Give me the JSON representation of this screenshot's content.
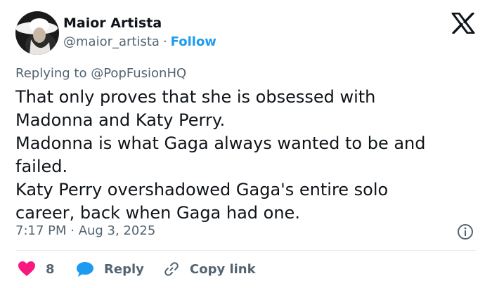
{
  "author": {
    "name": "Maior Artista",
    "handle": "@maior_artista",
    "separator": "·",
    "follow_label": "Follow"
  },
  "brand": {
    "icon": "x-logo-icon"
  },
  "reply_context": {
    "prefix": "Replying to",
    "mention": "@PopFusionHQ"
  },
  "tweet": {
    "lines": [
      "That only proves that she is obsessed with",
      "Madonna and Katy Perry.",
      "Madonna is what Gaga always wanted to be and",
      "failed.",
      "Katy Perry overshadowed Gaga's entire solo",
      "career, back when Gaga had one."
    ],
    "timestamp": "7:17 PM · Aug 3, 2025"
  },
  "actions": {
    "like_count": "8",
    "reply_label": "Reply",
    "copy_link_label": "Copy link"
  },
  "colors": {
    "text": "#0f1419",
    "secondary": "#536471",
    "accent": "#1d9bf0",
    "like": "#f91880",
    "reply_bubble": "#1d9bf0"
  }
}
